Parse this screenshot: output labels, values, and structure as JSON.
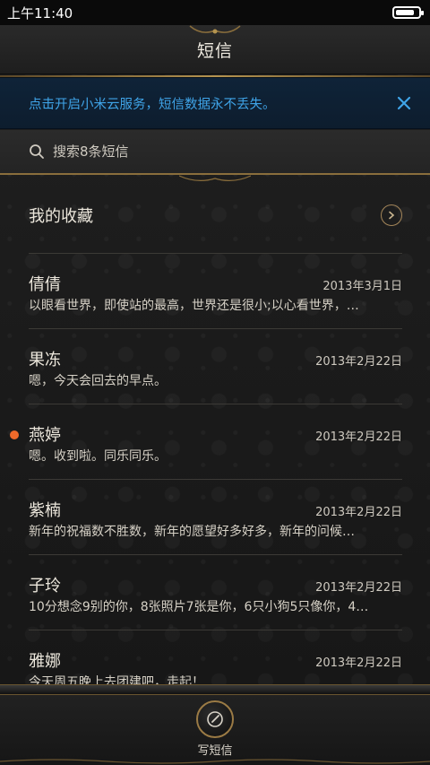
{
  "status_bar": {
    "time": "上午11:40",
    "battery_level": 0.85
  },
  "header": {
    "title": "短信"
  },
  "banner": {
    "text": "点击开启小米云服务，短信数据永不丢失。",
    "close_icon": "close-icon"
  },
  "search": {
    "placeholder": "搜索8条短信"
  },
  "favorites": {
    "label": "我的收藏",
    "icon": "chevron-right-icon"
  },
  "threads": [
    {
      "name": "倩倩",
      "date": "2013年3月1日",
      "preview": "以眼看世界，即使站的最高，世界还是很小;以心看世界，…",
      "unread": false
    },
    {
      "name": "果冻",
      "date": "2013年2月22日",
      "preview": "嗯，今天会回去的早点。",
      "unread": false
    },
    {
      "name": "燕婷",
      "date": "2013年2月22日",
      "preview": "嗯。收到啦。同乐同乐。",
      "unread": true
    },
    {
      "name": "紫楠",
      "date": "2013年2月22日",
      "preview": "新年的祝福数不胜数，新年的愿望好多好多，新年的问候…",
      "unread": false
    },
    {
      "name": "子玲",
      "date": "2013年2月22日",
      "preview": "10分想念9别的你，8张照片7张是你，6只小狗5只像你，4…",
      "unread": false
    },
    {
      "name": "雅娜",
      "date": "2013年2月22日",
      "preview": "今天周五晚上去团建吧，走起！",
      "unread": false
    }
  ],
  "bottom_bar": {
    "compose_label": "写短信",
    "compose_icon": "compose-icon"
  },
  "colors": {
    "banner_text": "#3fa4e8",
    "unread_dot": "#f06a2a",
    "gold_accent": "#b4934f"
  }
}
